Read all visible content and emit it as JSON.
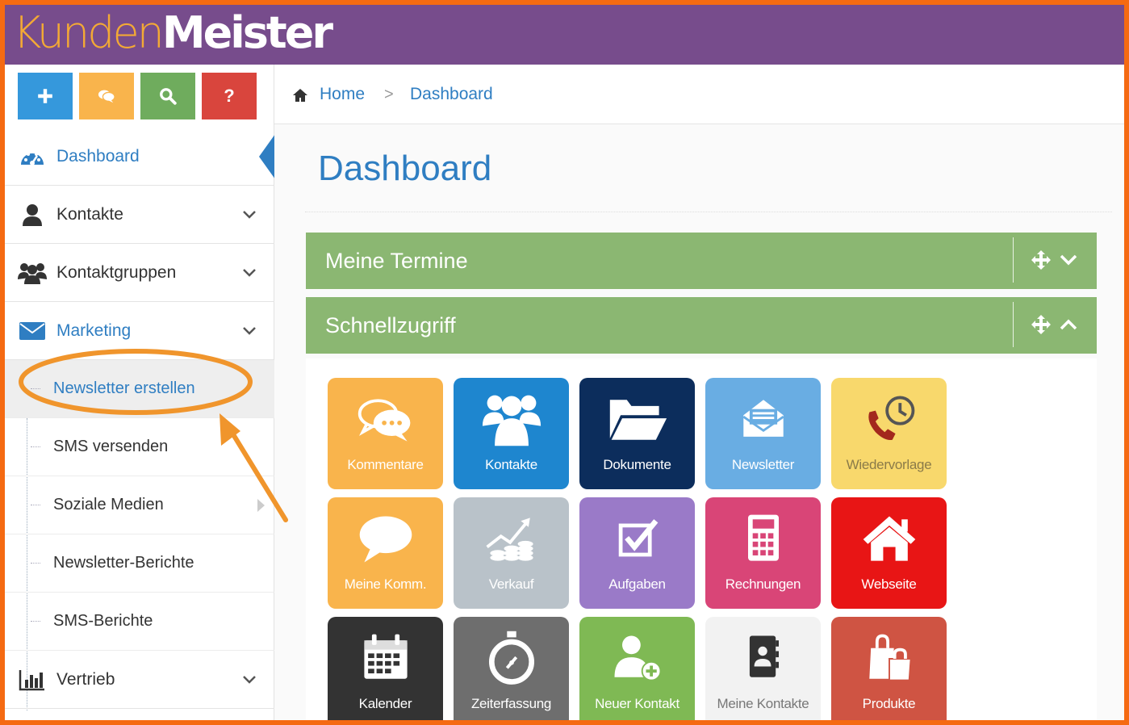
{
  "app": {
    "logo_part1": "Kunden",
    "logo_part2": "Meister"
  },
  "colors": {
    "header_purple": "#774c8c",
    "accent_blue": "#2f7ec2",
    "panel_green": "#8bb772",
    "frame_orange": "#f56a12",
    "annotation_orange": "#f0952c"
  },
  "shortcuts": [
    {
      "icon": "plus-icon",
      "color": "#3598dc"
    },
    {
      "icon": "comments-icon",
      "color": "#f9b44c"
    },
    {
      "icon": "search-icon",
      "color": "#6fac5d"
    },
    {
      "icon": "question-icon",
      "color": "#d9453d",
      "label": "?"
    }
  ],
  "sidebar": {
    "items": [
      {
        "label": "Dashboard",
        "icon": "dashboard-icon",
        "active": true
      },
      {
        "label": "Kontakte",
        "icon": "user-icon"
      },
      {
        "label": "Kontaktgruppen",
        "icon": "users-icon"
      },
      {
        "label": "Marketing",
        "icon": "envelope-icon",
        "expanded": true
      },
      {
        "label": "Vertrieb",
        "icon": "bar-chart-icon"
      }
    ],
    "marketing_sub": [
      {
        "label": "Newsletter erstellen",
        "highlighted": true
      },
      {
        "label": "SMS versenden"
      },
      {
        "label": "Soziale Medien"
      },
      {
        "label": "Newsletter-Berichte"
      },
      {
        "label": "SMS-Berichte"
      }
    ]
  },
  "breadcrumb": {
    "home": "Home",
    "separator": ">",
    "current": "Dashboard"
  },
  "page": {
    "title": "Dashboard"
  },
  "panels": [
    {
      "title": "Meine Termine",
      "collapsed": true
    },
    {
      "title": "Schnellzugriff",
      "collapsed": false
    }
  ],
  "tiles": [
    {
      "label": "Kommentare",
      "icon": "comments-icon",
      "color": "#f9b44c"
    },
    {
      "label": "Kontakte",
      "icon": "users-icon",
      "color": "#1e86cf"
    },
    {
      "label": "Dokumente",
      "icon": "folder-open-icon",
      "color": "#0c2d5c"
    },
    {
      "label": "Newsletter",
      "icon": "newsletter-icon",
      "color": "#69ade3"
    },
    {
      "label": "Wiedervorlage",
      "icon": "phone-clock-icon",
      "color": "#f8d86c",
      "text_color": "#8b7b49"
    },
    {
      "label": "Meine Komm.",
      "icon": "speech-bubble-icon",
      "color": "#f9b44c"
    },
    {
      "label": "Verkauf",
      "icon": "sales-growth-icon",
      "color": "#b9c2c9"
    },
    {
      "label": "Aufgaben",
      "icon": "task-check-icon",
      "color": "#9a7ac8"
    },
    {
      "label": "Rechnungen",
      "icon": "calculator-icon",
      "color": "#d94577"
    },
    {
      "label": "Webseite",
      "icon": "home-icon",
      "color": "#e81515"
    },
    {
      "label": "Kalender",
      "icon": "calendar-icon",
      "color": "#333333"
    },
    {
      "label": "Zeiterfassung",
      "icon": "stopwatch-icon",
      "color": "#6e6e6e"
    },
    {
      "label": "Neuer Kontakt",
      "icon": "add-user-icon",
      "color": "#7fb954"
    },
    {
      "label": "Meine Kontakte",
      "icon": "address-book-icon",
      "color": "#f2f2f2",
      "text_color": "#777777"
    },
    {
      "label": "Produkte",
      "icon": "shopping-bags-icon",
      "color": "#cf5443"
    }
  ]
}
